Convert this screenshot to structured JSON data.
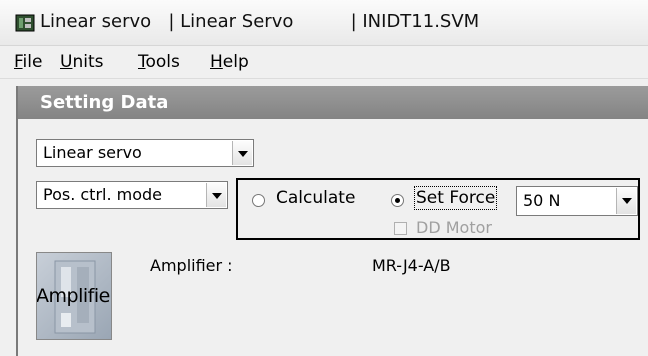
{
  "window": {
    "title": "Linear servo   | Linear Servo          | INIDT11.SVM",
    "icon": "servo-app-icon"
  },
  "menu": {
    "items": [
      {
        "mnemonic": "F",
        "rest": "ile"
      },
      {
        "mnemonic": "U",
        "rest": "nits"
      },
      {
        "mnemonic": "T",
        "rest": "ools"
      },
      {
        "mnemonic": "H",
        "rest": "elp"
      }
    ]
  },
  "panel": {
    "title": "Setting Data"
  },
  "settings": {
    "servo_type": "Linear servo",
    "control_mode": "Pos. ctrl. mode",
    "calculate_label": "Calculate",
    "set_force_label": "Set Force",
    "set_force_selected": true,
    "force_value": "50 N",
    "dd_motor_label": "DD Motor",
    "dd_motor_enabled": false
  },
  "amplifier": {
    "button_label": "Amplifier",
    "field_label": "Amplifier :",
    "model": "MR-J4-A/B"
  }
}
